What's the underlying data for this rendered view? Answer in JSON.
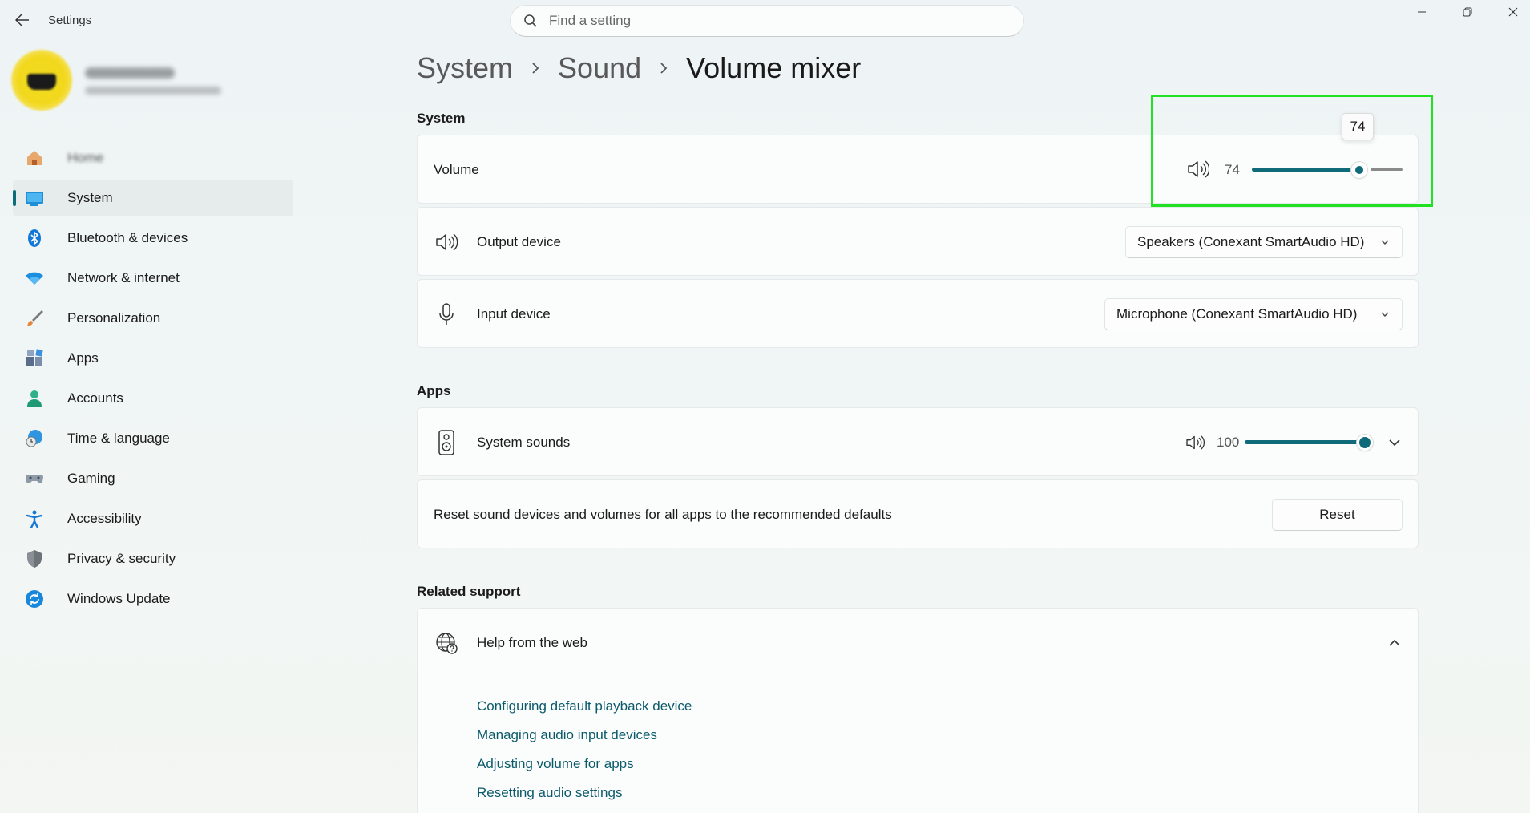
{
  "window": {
    "title": "Settings",
    "search_placeholder": "Find a setting"
  },
  "sidebar": {
    "items": [
      {
        "label": "Home",
        "icon": "home-icon"
      },
      {
        "label": "System",
        "icon": "system-icon",
        "active": true
      },
      {
        "label": "Bluetooth & devices",
        "icon": "bluetooth-icon"
      },
      {
        "label": "Network & internet",
        "icon": "wifi-icon"
      },
      {
        "label": "Personalization",
        "icon": "brush-icon"
      },
      {
        "label": "Apps",
        "icon": "apps-icon"
      },
      {
        "label": "Accounts",
        "icon": "accounts-icon"
      },
      {
        "label": "Time & language",
        "icon": "globe-clock-icon"
      },
      {
        "label": "Gaming",
        "icon": "gamepad-icon"
      },
      {
        "label": "Accessibility",
        "icon": "accessibility-icon"
      },
      {
        "label": "Privacy & security",
        "icon": "shield-icon"
      },
      {
        "label": "Windows Update",
        "icon": "update-icon"
      }
    ]
  },
  "breadcrumb": [
    "System",
    "Sound",
    "Volume mixer"
  ],
  "system_section": {
    "title": "System",
    "volume": {
      "label": "Volume",
      "value": "74",
      "level": 74,
      "tooltip": "74"
    },
    "output_device": {
      "label": "Output device",
      "selected": "Speakers (Conexant SmartAudio HD)"
    },
    "input_device": {
      "label": "Input device",
      "selected": "Microphone (Conexant SmartAudio HD)"
    }
  },
  "apps_section": {
    "title": "Apps",
    "system_sounds": {
      "label": "System sounds",
      "value": "100",
      "level": 100
    },
    "reset": {
      "label": "Reset sound devices and volumes for all apps to the recommended defaults",
      "button": "Reset"
    }
  },
  "related_support": {
    "title": "Related support",
    "help": {
      "label": "Help from the web"
    },
    "links": [
      "Configuring default playback device",
      "Managing audio input devices",
      "Adjusting volume for apps",
      "Resetting audio settings"
    ]
  },
  "colors": {
    "accent": "#0f6a7a",
    "highlight": "#22e022"
  }
}
